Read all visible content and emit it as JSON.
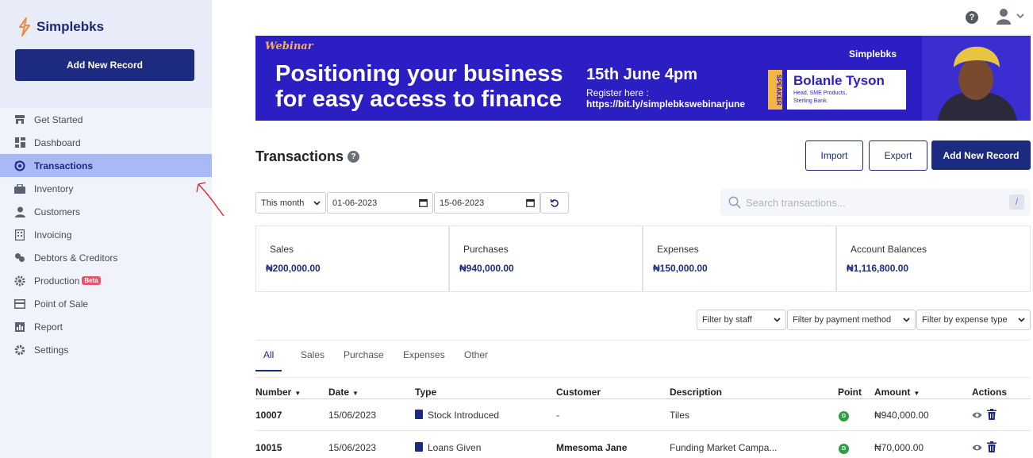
{
  "app": {
    "brand": "Simplebks",
    "add_new_record": "Add New Record"
  },
  "sidebar": {
    "items": [
      {
        "label": "Get Started",
        "icon": "store-icon"
      },
      {
        "label": "Dashboard",
        "icon": "dashboard-icon"
      },
      {
        "label": "Transactions",
        "icon": "transactions-icon",
        "active": true
      },
      {
        "label": "Inventory",
        "icon": "briefcase-icon"
      },
      {
        "label": "Customers",
        "icon": "user-icon"
      },
      {
        "label": "Invoicing",
        "icon": "invoice-icon"
      },
      {
        "label": "Debtors & Creditors",
        "icon": "coins-icon"
      },
      {
        "label": "Production",
        "icon": "cog-badge-icon",
        "badge": "Beta"
      },
      {
        "label": "Point of Sale",
        "icon": "pos-icon"
      },
      {
        "label": "Report",
        "icon": "report-icon"
      },
      {
        "label": "Settings",
        "icon": "gear-icon"
      }
    ]
  },
  "banner": {
    "tag": "Webinar",
    "headline_line1": "Positioning your business",
    "headline_line2": "for easy access to finance",
    "date": "15th June 4pm",
    "register_label": "Register here :",
    "register_link": "https://bit.ly/simplebkswebinarjune",
    "brand": "Simplebks",
    "speaker_tag": "SPEAKER",
    "speaker_name": "Bolanle Tyson",
    "speaker_role_line1": "Head, SME Products,",
    "speaker_role_line2": "Sterling Bank."
  },
  "page": {
    "title": "Transactions",
    "help": "?",
    "import_label": "Import",
    "export_label": "Export",
    "add_label": "Add New Record"
  },
  "filters": {
    "period": "This month",
    "date_from": "01-06-2023",
    "date_to": "15-06-2023",
    "search_placeholder": "Search transactions...",
    "search_shortcut": "/",
    "staff": "Filter by staff",
    "payment_method": "Filter by payment method",
    "expense_type": "Filter by expense type"
  },
  "summary": [
    {
      "label": "Sales",
      "amount": "₦200,000.00"
    },
    {
      "label": "Purchases",
      "amount": "₦940,000.00"
    },
    {
      "label": "Expenses",
      "amount": "₦150,000.00"
    },
    {
      "label": "Account Balances",
      "amount": "₦1,116,800.00"
    }
  ],
  "tabs": [
    "All",
    "Sales",
    "Purchase",
    "Expenses",
    "Other"
  ],
  "table": {
    "headers": {
      "number": "Number",
      "date": "Date",
      "type": "Type",
      "customer": "Customer",
      "description": "Description",
      "point": "Point",
      "amount": "Amount",
      "actions": "Actions"
    },
    "rows": [
      {
        "number": "10007",
        "date": "15/06/2023",
        "type": "Stock Introduced",
        "customer": "-",
        "description": "Tiles",
        "point": "D",
        "amount": "₦940,000.00"
      },
      {
        "number": "10015",
        "date": "15/06/2023",
        "type": "Loans Given",
        "customer": "Mmesoma Jane",
        "description": "Funding Market Campa...",
        "point": "D",
        "amount": "₦70,000.00"
      }
    ]
  },
  "colors": {
    "primary": "#1c2a80",
    "active_nav": "#a9b9f5",
    "banner": "#2b1fc4",
    "point_badge": "#2ea043"
  }
}
